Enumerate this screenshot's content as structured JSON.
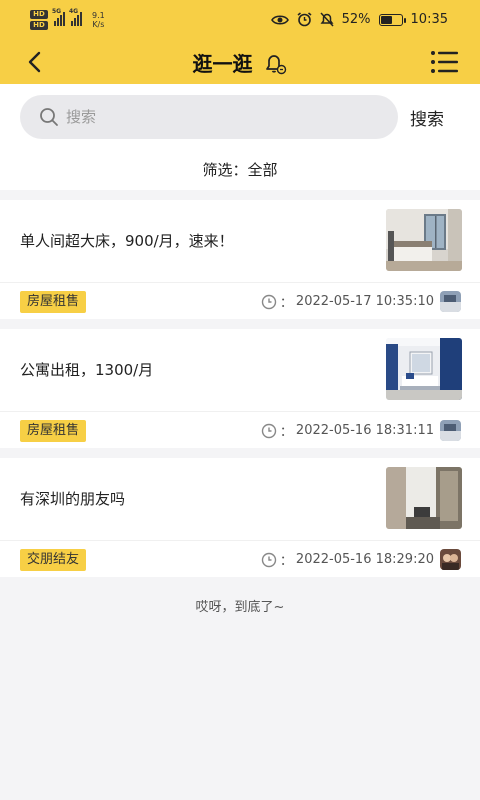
{
  "status_bar": {
    "network_badge_1": "HD",
    "network_badge_2": "HD",
    "signal_1_label": "5G",
    "signal_2_label": "4G",
    "speed_value": "9.1",
    "speed_unit": "K/s",
    "battery": "52%",
    "time": "10:35"
  },
  "header": {
    "title": "逛一逛"
  },
  "search": {
    "placeholder": "搜索",
    "button_label": "搜索"
  },
  "filter": {
    "label": "筛选：全部"
  },
  "posts": [
    {
      "text": "单人间超大床，900/月，速来！",
      "tag": "房屋租售",
      "time": "2022-05-17 10:35:10"
    },
    {
      "text": "公寓出租，1300/月",
      "tag": "房屋租售",
      "time": "2022-05-16 18:31:11"
    },
    {
      "text": "有深圳的朋友吗",
      "tag": "交朋结友",
      "time": "2022-05-16 18:29:20"
    }
  ],
  "footer": {
    "end_text": "哎呀，到底了~"
  },
  "colors": {
    "accent": "#f7cf45",
    "background": "#f4f4f6"
  }
}
